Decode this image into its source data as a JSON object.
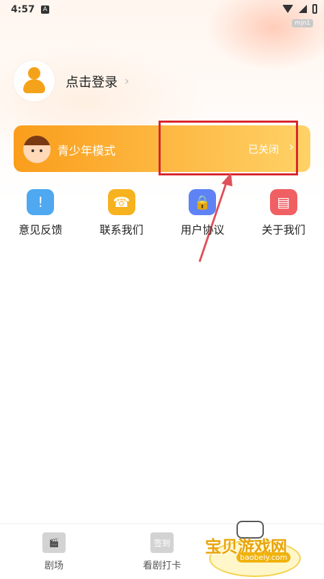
{
  "status_bar": {
    "time": "4:57",
    "badge": "A",
    "tag": "mjn1"
  },
  "profile": {
    "login_label": "点击登录",
    "chevron": "›"
  },
  "teen_mode": {
    "title": "青少年模式",
    "status": "已关闭",
    "chevron": "›"
  },
  "quick_actions": [
    {
      "label": "意见反馈",
      "icon": "feedback-icon",
      "color": "#4fa8f0",
      "glyph": "!"
    },
    {
      "label": "联系我们",
      "icon": "phone-icon",
      "color": "#f6b21f",
      "glyph": "☎"
    },
    {
      "label": "用户协议",
      "icon": "lock-icon",
      "color": "#5f83f5",
      "glyph": "🔒"
    },
    {
      "label": "关于我们",
      "icon": "book-icon",
      "color": "#f06063",
      "glyph": "▤"
    }
  ],
  "bottom_nav": [
    {
      "label": "剧场",
      "icon": "clapperboard-icon",
      "glyph": "🎬"
    },
    {
      "label": "看剧打卡",
      "icon": "checkin-icon",
      "glyph": "签到"
    }
  ],
  "watermark": {
    "title": "宝贝游戏网",
    "url": "baobeiy.com"
  },
  "colors": {
    "accent": "#fa9d1b",
    "highlight": "#d9232b"
  }
}
